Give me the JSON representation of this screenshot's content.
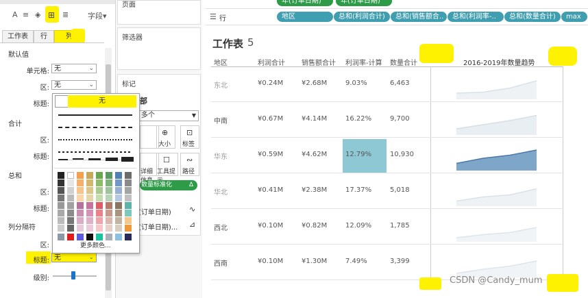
{
  "toolbar": {
    "text_icon": "A",
    "align_icon": "≡",
    "paint_icon": "◈",
    "borders_icon": "⊞",
    "lines_icon": "≣",
    "field_label": "字段▾"
  },
  "tabs": [
    "工作表",
    "行",
    "列"
  ],
  "format_panel": {
    "default_section": "默认值",
    "cell_label": "单元格:",
    "cell_value": "无",
    "area_label": "区:",
    "area_value": "无",
    "header_label": "标题:",
    "total_section": "合计",
    "total_area_label": "区:",
    "total_header_label": "标题:",
    "grand_section": "总和",
    "grand_area_label": "区:",
    "grand_header_label": "标题:",
    "divider_section": "列分隔符",
    "divider_area_label": "区:",
    "divider_header_label": "标题:",
    "divider_header_value": "无",
    "level_label": "级别:"
  },
  "popup": {
    "none_label": "无",
    "more_colors": "更多颜色..."
  },
  "middle_pane": {
    "top_label": "页面",
    "filters": "筛选器",
    "marks": "标记",
    "marks_all": "部",
    "marks_type": "多个",
    "size_btn": "大小",
    "label_btn": "标签",
    "detail_btn": "详细信息",
    "tooltip_btn": "工具提示",
    "path_btn": "路径",
    "pill_measure": "数量标准化",
    "pill_measure_icon": "Δ",
    "field1": "(订单日期)",
    "field2": "(订单日期)...",
    "line_icon": "∿",
    "area_icon": "⊿"
  },
  "shelf": {
    "rows_icon": "☰",
    "rows_label": "行",
    "pills": [
      "地区",
      "总和(利润合计)",
      "总和(销售额合..",
      "总和(利润率-..",
      "总和(数量合计)",
      "max"
    ],
    "top_pills": [
      "年(订单日期)",
      "年(订单日期)"
    ]
  },
  "worksheet": {
    "title": "工作表",
    "title_num": "5",
    "headers": [
      "地区",
      "利润合计",
      "销售额合计",
      "利润率-计算",
      "数量合计",
      "2016-2019年数量趋势"
    ],
    "rows": [
      {
        "region": "东北",
        "profit": "¥0.24M",
        "sales": "¥2.68M",
        "rate": "9.03%",
        "qty": "6,463"
      },
      {
        "region": "中南",
        "profit": "¥0.67M",
        "sales": "¥4.14M",
        "rate": "16.22%",
        "qty": "9,700"
      },
      {
        "region": "华东",
        "profit": "¥0.59M",
        "sales": "¥4.62M",
        "rate": "12.79%",
        "qty": "10,930"
      },
      {
        "region": "华北",
        "profit": "¥0.41M",
        "sales": "¥2.38M",
        "rate": "17.37%",
        "qty": "5,018"
      },
      {
        "region": "西北",
        "profit": "¥0.10M",
        "sales": "¥0.82M",
        "rate": "12.09%",
        "qty": "1,785"
      },
      {
        "region": "西南",
        "profit": "¥0.10M",
        "sales": "¥1.30M",
        "rate": "7.49%",
        "qty": "3,399"
      }
    ],
    "highlight_color": "#8ec8d4",
    "watermark": "CSDN @Candy_mum"
  },
  "colors": {
    "accent_yellow": "#fff200",
    "pill_blue": "#3f9eb0",
    "pill_green": "#2d9b48",
    "area_highlight": "#7ea6c8"
  }
}
